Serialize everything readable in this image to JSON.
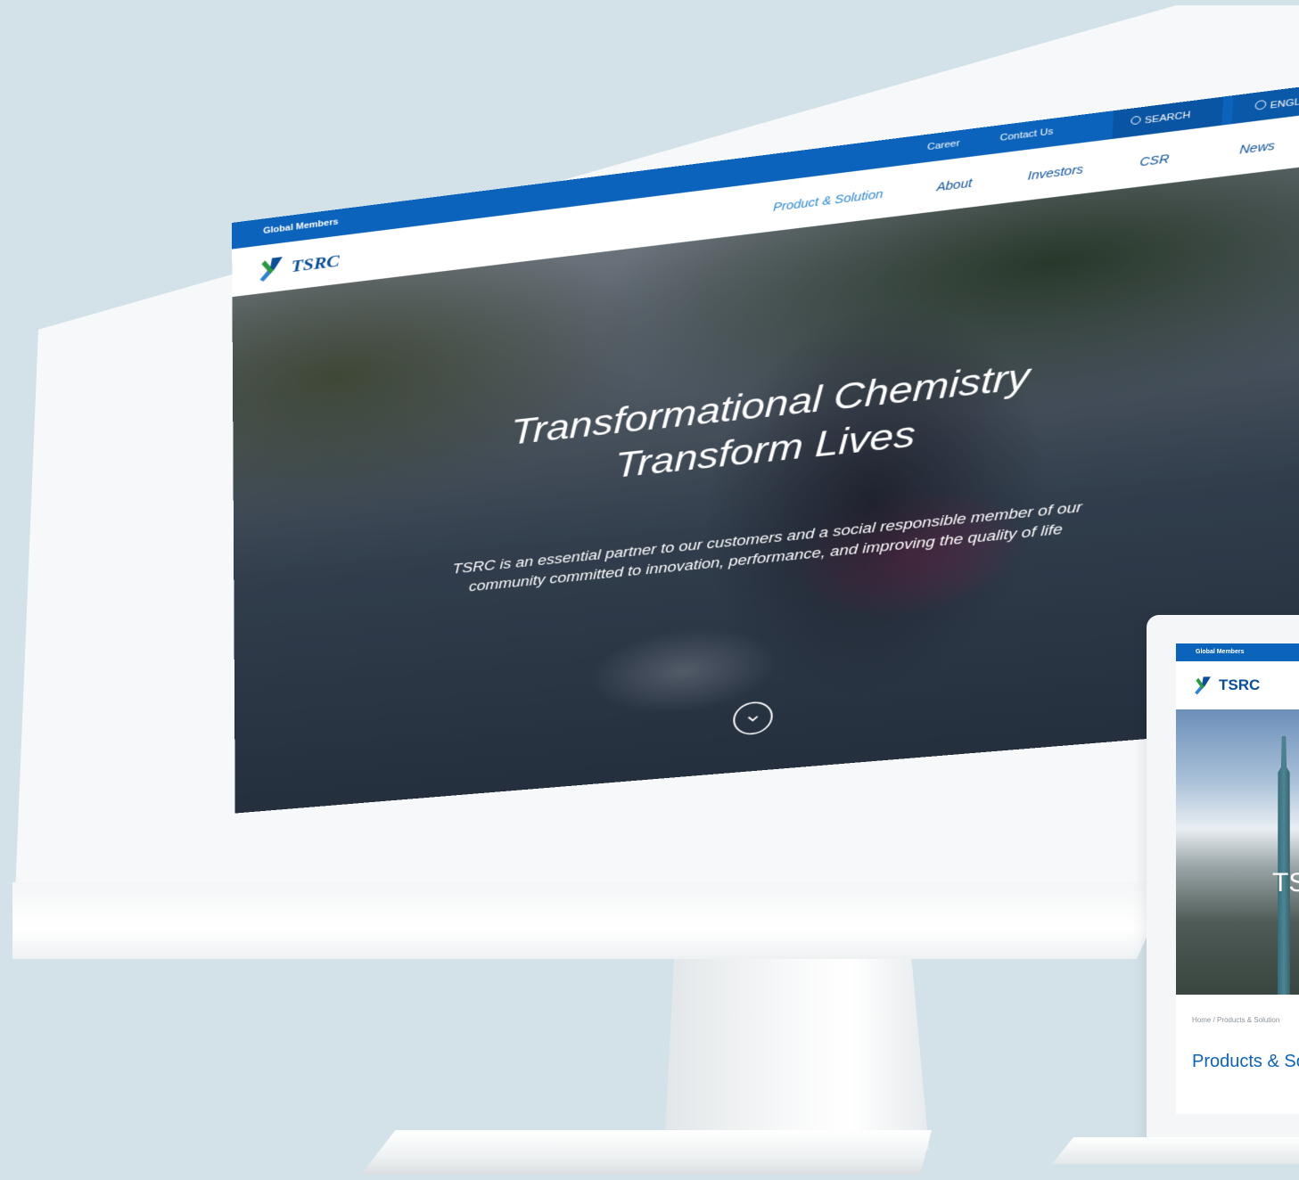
{
  "imac": {
    "top_bar": {
      "global_members": "Global Members",
      "career": "Career",
      "contact_us": "Contact Us",
      "search": "SEARCH",
      "language": "ENGLISH"
    },
    "logo_text": "TSRC",
    "nav": {
      "items": [
        {
          "label": "Product & Solution",
          "active": true
        },
        {
          "label": "About"
        },
        {
          "label": "Investors"
        },
        {
          "label": "CSR"
        },
        {
          "label": "News"
        }
      ]
    },
    "hero": {
      "title_line1": "Transformational Chemistry",
      "title_line2": "Transform Lives",
      "subtitle_line1": "TSRC is an essential partner to our customers and a social responsible member of our",
      "subtitle_line2": "community committed to innovation, performance, and improving the quality of life"
    },
    "icons": {
      "scroll": "chevron-down-circle-icon",
      "search": "search-icon",
      "language": "globe-icon"
    }
  },
  "laptop": {
    "top_bar": "Global Members",
    "logo_text": "TSRC",
    "hero_text": "TS",
    "breadcrumb": "Home / Products & Solution",
    "page_title": "Products & So"
  },
  "colors": {
    "brand_blue": "#0b63bb",
    "nav_text": "#0b4f9a",
    "background": "#d3e2e8"
  }
}
